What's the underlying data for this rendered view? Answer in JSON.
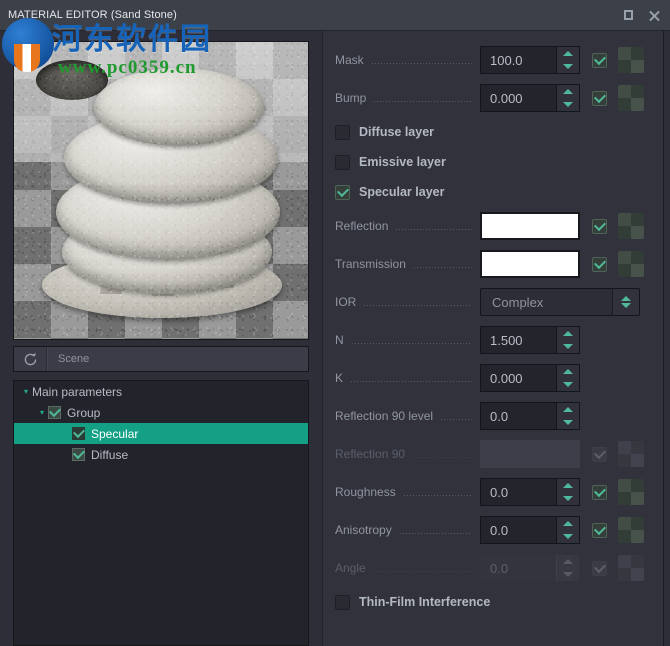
{
  "window": {
    "title": "MATERIAL EDITOR (Sand Stone)",
    "maximize_icon": "maximize-icon",
    "close_icon": "close-icon"
  },
  "preview": {
    "alt": "sand stone material preview",
    "refresh_icon": "refresh-icon",
    "scene_value": "Scene"
  },
  "tree": {
    "nodes": [
      {
        "label": "Main parameters",
        "level": 1,
        "caret": "▾",
        "has_checkbox": false,
        "checked": false,
        "selected": false
      },
      {
        "label": "Group",
        "level": 2,
        "caret": "▾",
        "has_checkbox": true,
        "checked": true,
        "selected": false
      },
      {
        "label": "Specular",
        "level": 3,
        "caret": "",
        "has_checkbox": true,
        "checked": true,
        "selected": true
      },
      {
        "label": "Diffuse",
        "level": 3,
        "caret": "",
        "has_checkbox": true,
        "checked": true,
        "selected": false
      }
    ]
  },
  "params": {
    "rows": [
      {
        "kind": "spin",
        "label": "Mask",
        "value": "100.0",
        "enabled": true,
        "check": true,
        "swatch": true
      },
      {
        "kind": "spin",
        "label": "Bump",
        "value": "0.000",
        "enabled": true,
        "check": true,
        "swatch": true
      },
      {
        "kind": "layer",
        "label": "Diffuse layer",
        "checked": false
      },
      {
        "kind": "layer",
        "label": "Emissive layer",
        "checked": false
      },
      {
        "kind": "layer",
        "label": "Specular layer",
        "checked": true
      },
      {
        "kind": "color",
        "label": "Reflection",
        "value": "#ffffff",
        "enabled": true,
        "check": true,
        "swatch": true
      },
      {
        "kind": "color",
        "label": "Transmission",
        "value": "#ffffff",
        "enabled": true,
        "check": true,
        "swatch": true
      },
      {
        "kind": "combo",
        "label": "IOR",
        "value": "Complex",
        "enabled": true,
        "check": false,
        "swatch": false
      },
      {
        "kind": "spin",
        "label": "N",
        "value": "1.500",
        "enabled": true,
        "check": false,
        "swatch": false
      },
      {
        "kind": "spin",
        "label": "K",
        "value": "0.000",
        "enabled": true,
        "check": false,
        "swatch": false
      },
      {
        "kind": "spin",
        "label": "Reflection 90 level",
        "value": "0.0",
        "enabled": true,
        "check": false,
        "swatch": false
      },
      {
        "kind": "flat",
        "label": "Reflection 90",
        "value": "",
        "enabled": false,
        "check": true,
        "swatch": true
      },
      {
        "kind": "spin",
        "label": "Roughness",
        "value": "0.0",
        "enabled": true,
        "check": true,
        "swatch": true
      },
      {
        "kind": "spin",
        "label": "Anisotropy",
        "value": "0.0",
        "enabled": true,
        "check": true,
        "swatch": true
      },
      {
        "kind": "spin",
        "label": "Angle",
        "value": "0.0",
        "enabled": false,
        "check": true,
        "swatch": true
      },
      {
        "kind": "layer",
        "label": "Thin-Film Interference",
        "checked": false
      }
    ]
  },
  "watermark": {
    "chinese": "河东软件园",
    "url": "www.pc0359.cn"
  },
  "colors": {
    "accent": "#13a085",
    "tick": "#4fb99a",
    "titlebar": "#3b4049",
    "panel": "#32323c"
  }
}
